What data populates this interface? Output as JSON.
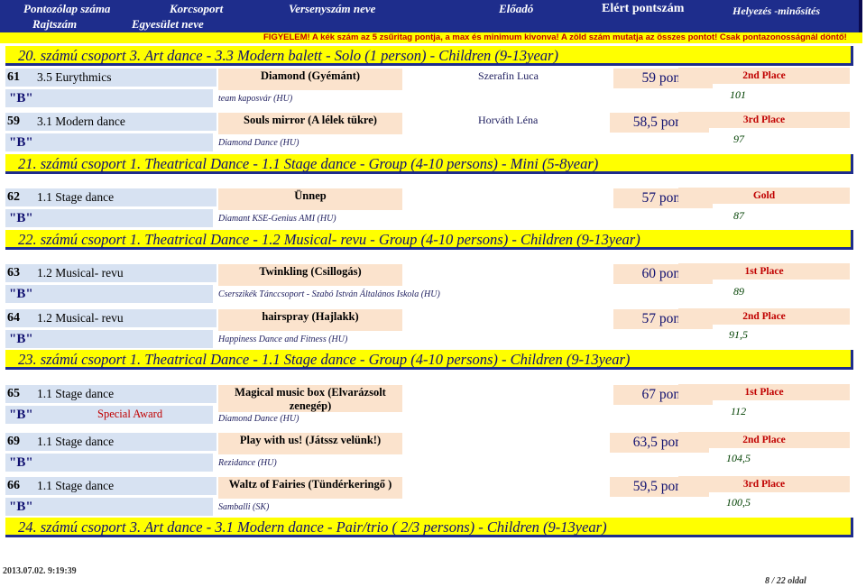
{
  "header": {
    "col1": "Pontozólap száma",
    "col1b": "Rajtszám",
    "col2": "Korcsoport",
    "col2b": "Egyesület neve",
    "col3": "Versenyszám neve",
    "col4": "Előadó",
    "col5": "Elért pontszám",
    "col6": "Helyezés -minősítés",
    "notice": "FIGYELEM! A kék szám az 5 zsűritag pontja, a max és minimum kivonva! A zöld szám mutatja az összes pontot! Csak pontazonosságnál döntő!"
  },
  "groups": [
    "20. számú csoport   3. Art dance - 3.3 Modern balett - Solo (1 person) - Children (9-13year)",
    "21. számú csoport   1. Theatrical Dance - 1.1 Stage dance - Group (4-10 persons) - Mini (5-8year)",
    "22. számú csoport   1. Theatrical Dance - 1.2 Musical- revu - Group (4-10 persons) - Children (9-13year)",
    "23. számú csoport   1. Theatrical Dance - 1.1 Stage dance - Group (4-10 persons) - Children (9-13year)",
    "24. számú csoport   3. Art dance - 3.1 Modern dance - Pair/trio ( 2/3 persons) - Children (9-13year)"
  ],
  "entries": [
    {
      "num": "61",
      "category": "3.5 Eurythmics",
      "title": "Diamond (Gyémánt)",
      "performer": "Szerafin Luca",
      "score": "59 pont",
      "place": "2nd Place",
      "b": "\"B\"",
      "team": "team kaposvár (HU)",
      "total": "101",
      "award": ""
    },
    {
      "num": "59",
      "category": "3.1 Modern dance",
      "title": "Souls mirror (A lélek tükre)",
      "performer": "Horváth Léna",
      "score": "58,5 pont",
      "place": "3rd Place",
      "b": "\"B\"",
      "team": "Diamond Dance (HU)",
      "total": "97",
      "award": ""
    },
    {
      "num": "62",
      "category": "1.1 Stage dance",
      "title": "Ünnep",
      "performer": "",
      "score": "57 pont",
      "place": "Gold",
      "b": "\"B\"",
      "team": "Diamant KSE-Genius AMI (HU)",
      "total": "87",
      "award": ""
    },
    {
      "num": "63",
      "category": "1.2 Musical- revu",
      "title": "Twinkling (Csillogás)",
      "performer": "",
      "score": "60 pont",
      "place": "1st Place",
      "b": "\"B\"",
      "team": "Cserszikék Tánccsoport - Szabó István Általános Iskola (HU)",
      "total": "89",
      "award": ""
    },
    {
      "num": "64",
      "category": "1.2 Musical- revu",
      "title": "hairspray (Hajlakk)",
      "performer": "",
      "score": "57 pont",
      "place": "2nd Place",
      "b": "\"B\"",
      "team": "Happiness Dance and Fitness (HU)",
      "total": "91,5",
      "award": ""
    },
    {
      "num": "65",
      "category": "1.1 Stage dance",
      "title": "Magical music box (Elvarázsolt zenegép)",
      "performer": "",
      "score": "67 pont",
      "place": "1st Place",
      "b": "\"B\"",
      "team": "Diamond Dance (HU)",
      "total": "112",
      "award": "Special Award"
    },
    {
      "num": "69",
      "category": "1.1 Stage dance",
      "title": "Play with us! (Játssz velünk!)",
      "performer": "",
      "score": "63,5 pont",
      "place": "2nd Place",
      "b": "\"B\"",
      "team": "Rezidance (HU)",
      "total": "104,5",
      "award": ""
    },
    {
      "num": "66",
      "category": "1.1 Stage dance",
      "title": "Waltz of Fairies (Tündérkeringő )",
      "performer": "",
      "score": "59,5 pont",
      "place": "3rd Place",
      "b": "\"B\"",
      "team": "Samballi (SK)",
      "total": "100,5",
      "award": ""
    }
  ],
  "footer": {
    "timestamp": "2013.07.02. 9:19:39",
    "page": "8 / 22 oldal"
  },
  "colors": {
    "header_bg": "#1e2d8c",
    "group_bar": "#ffff00",
    "title_box": "#fbe3cd",
    "category_box": "#d7e2f2",
    "place_text": "#c00000",
    "total_text": "#004000"
  }
}
